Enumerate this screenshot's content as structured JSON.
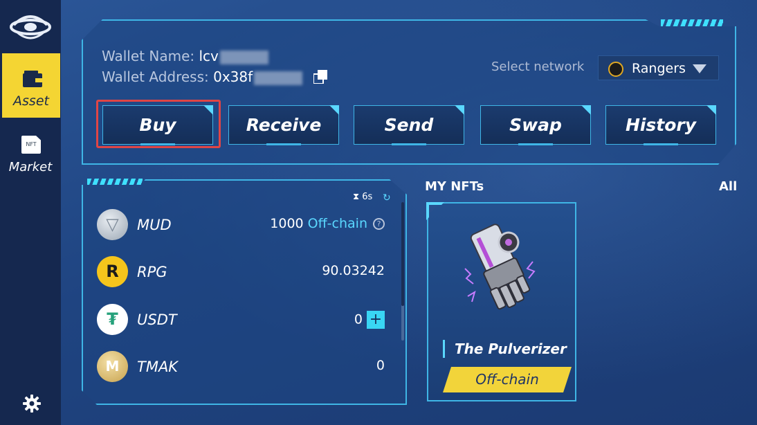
{
  "sidebar": {
    "asset_label": "Asset",
    "market_label": "Market",
    "market_icon_text": "NFT",
    "icons": [
      "logo-icon",
      "wallet-icon",
      "nft-icon",
      "gear-icon"
    ]
  },
  "wallet": {
    "name_label": "Wallet Name:",
    "name_value": "lcv",
    "address_label": "Wallet Address:",
    "address_value": "0x38f",
    "select_network_label": "Select network",
    "network": "Rangers"
  },
  "actions": {
    "buy": "Buy",
    "receive": "Receive",
    "send": "Send",
    "swap": "Swap",
    "history": "History"
  },
  "tokens": {
    "timer": "6s",
    "items": [
      {
        "symbol": "MUD",
        "amount": "1000",
        "tag": "Off-chain",
        "icon": "mud-coin-icon"
      },
      {
        "symbol": "RPG",
        "amount": "90.03242",
        "icon": "rpg-coin-icon"
      },
      {
        "symbol": "USDT",
        "amount": "0",
        "icon": "usdt-coin-icon"
      },
      {
        "symbol": "TMAK",
        "amount": "0",
        "icon": "tmak-coin-icon"
      }
    ]
  },
  "nfts": {
    "title": "MY NFTs",
    "all_label": "All",
    "items": [
      {
        "name": "The Pulverizer",
        "status": "Off-chain"
      }
    ]
  },
  "colors": {
    "accent_cyan": "#3fb6e6",
    "highlight_yellow": "#f4d533",
    "sidebar_bg": "#15284f",
    "selection_red": "#e04545"
  }
}
